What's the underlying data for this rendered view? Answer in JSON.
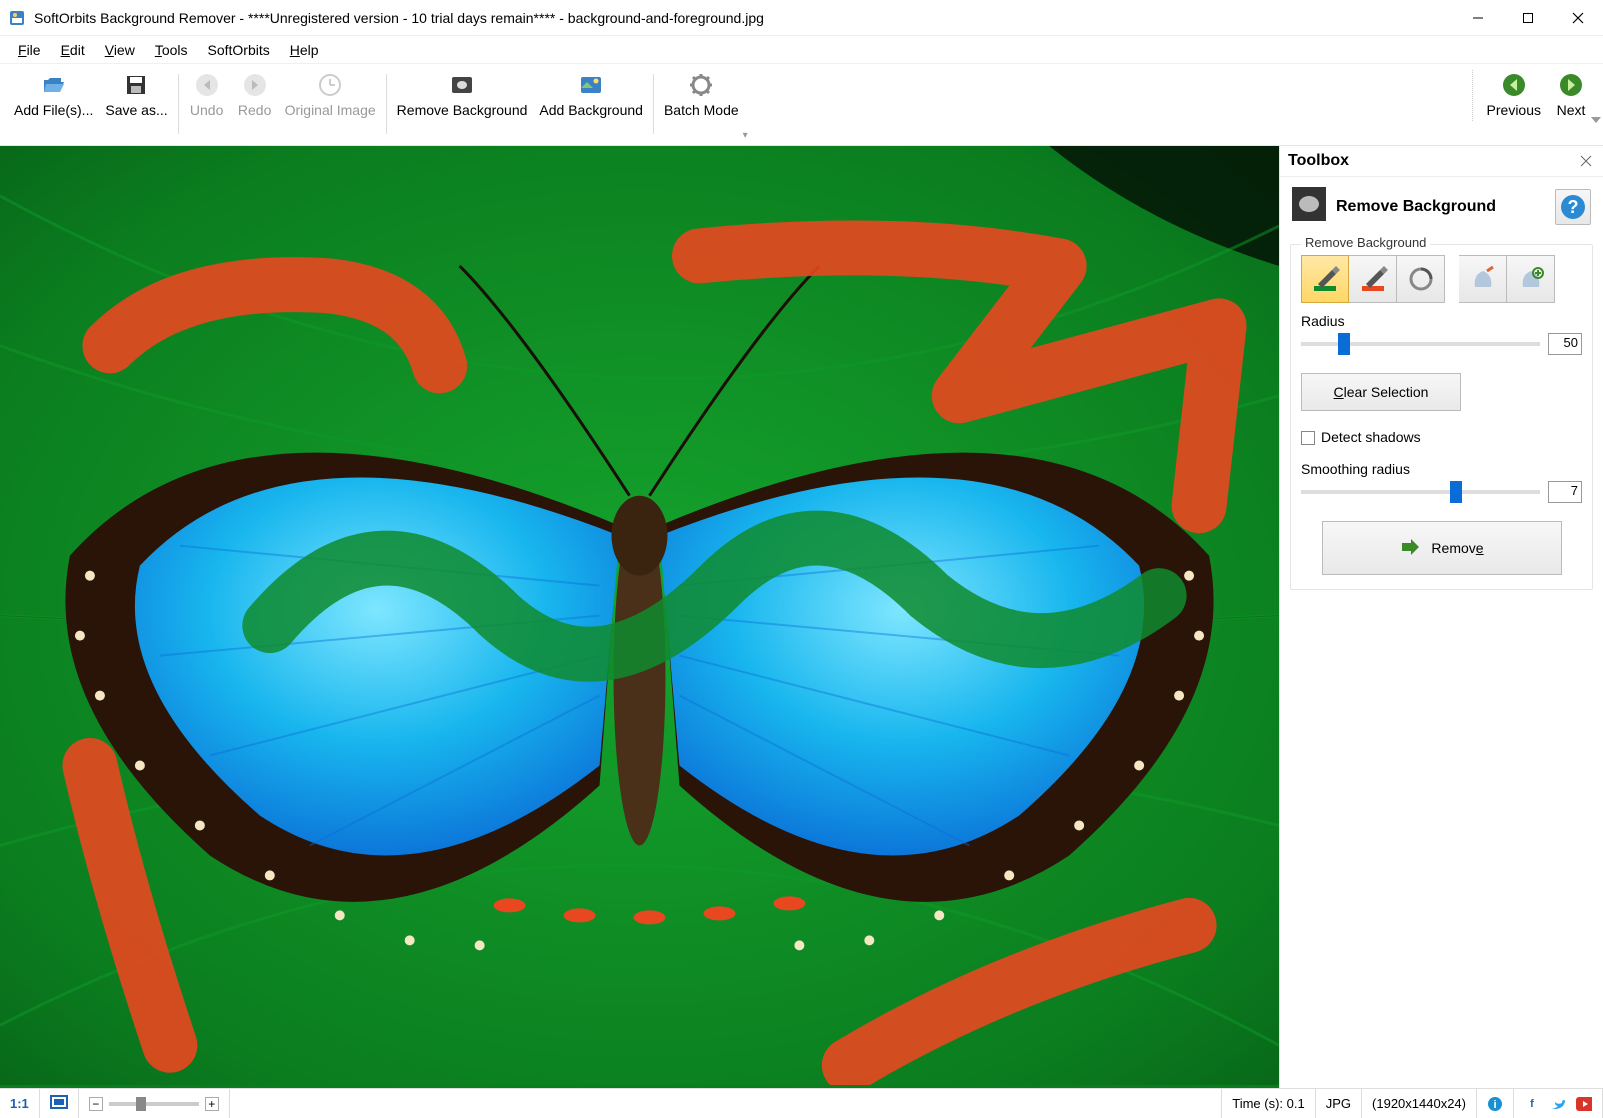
{
  "title": "SoftOrbits Background Remover - ****Unregistered version - 10 trial days remain**** - background-and-foreground.jpg",
  "menu": {
    "file": "File",
    "edit": "Edit",
    "view": "View",
    "tools": "Tools",
    "softorbits": "SoftOrbits",
    "help": "Help"
  },
  "toolbar": {
    "add_files": "Add File(s)...",
    "save_as": "Save as...",
    "undo": "Undo",
    "redo": "Redo",
    "original": "Original Image",
    "remove_bg": "Remove Background",
    "add_bg": "Add Background",
    "batch": "Batch Mode",
    "prev": "Previous",
    "next": "Next"
  },
  "toolbox": {
    "panel_title": "Toolbox",
    "heading": "Remove Background",
    "legend": "Remove Background",
    "radius_label": "Radius",
    "radius_value": "50",
    "clear_selection": "Clear Selection",
    "detect_shadows": "Detect shadows",
    "smoothing_label": "Smoothing radius",
    "smoothing_value": "7",
    "remove_label": "Remove"
  },
  "status": {
    "ratio": "1:1",
    "time": "Time (s): 0.1",
    "format": "JPG",
    "dims": "(1920x1440x24)"
  },
  "colors": {
    "fg_stroke": "#0F8B2E",
    "bg_stroke": "#E8471F",
    "accent": "#0a6cd6"
  }
}
